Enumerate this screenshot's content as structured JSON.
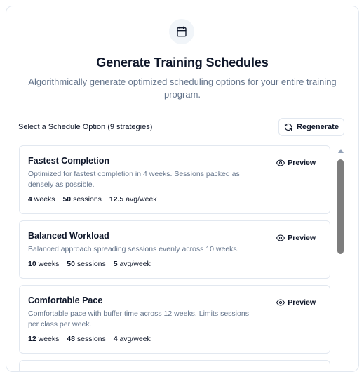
{
  "header": {
    "icon": "calendar-icon",
    "title": "Generate Training Schedules",
    "subtitle": "Algorithmically generate optimized scheduling options for your entire training program."
  },
  "toolbar": {
    "select_label": "Select a Schedule Option (9 strategies)",
    "regenerate_label": "Regenerate",
    "regenerate_icon": "refresh-icon"
  },
  "options": [
    {
      "name": "Fastest Completion",
      "description": "Optimized for fastest completion in 4 weeks. Sessions packed as densely as possible.",
      "weeks_value": "4",
      "weeks_unit": "weeks",
      "sessions_value": "50",
      "sessions_unit": "sessions",
      "avg_value": "12.5",
      "avg_unit": "avg/week",
      "preview_label": "Preview"
    },
    {
      "name": "Balanced Workload",
      "description": "Balanced approach spreading sessions evenly across 10 weeks.",
      "weeks_value": "10",
      "weeks_unit": "weeks",
      "sessions_value": "50",
      "sessions_unit": "sessions",
      "avg_value": "5",
      "avg_unit": "avg/week",
      "preview_label": "Preview"
    },
    {
      "name": "Comfortable Pace",
      "description": "Comfortable pace with buffer time across 12 weeks. Limits sessions per class per week.",
      "weeks_value": "12",
      "weeks_unit": "weeks",
      "sessions_value": "48",
      "sessions_unit": "sessions",
      "avg_value": "4",
      "avg_unit": "avg/week",
      "preview_label": "Preview"
    }
  ],
  "colors": {
    "text": "#0f172a",
    "muted": "#64748b",
    "border": "#e2e8f0",
    "icon_bg": "#f1f5f9"
  }
}
